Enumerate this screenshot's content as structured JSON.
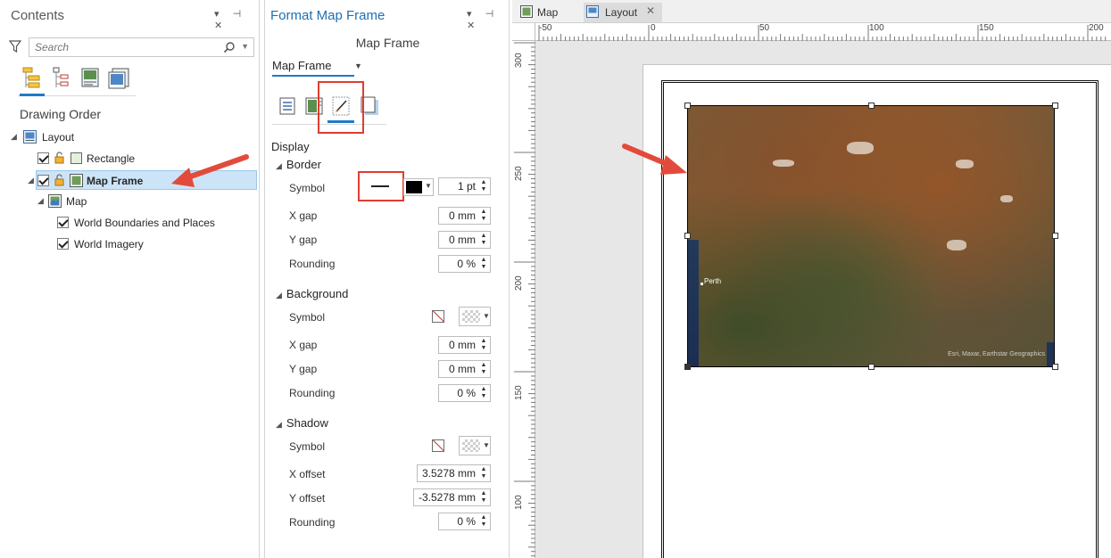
{
  "contents_pane": {
    "title": "Contents",
    "controls": "▾ ⊣ ✕",
    "search_placeholder": "Search",
    "view_tabs": [
      "list-by-drawing-order-icon",
      "list-by-selection-icon",
      "list-by-snapping-icon",
      "list-by-labeling-icon"
    ],
    "heading": "Drawing Order",
    "tree": {
      "layout": "Layout",
      "rectangle": "Rectangle",
      "map_frame": "Map Frame",
      "map": "Map",
      "world_boundaries": "World Boundaries and Places",
      "world_imagery": "World Imagery"
    }
  },
  "format_pane": {
    "title": "Format Map Frame",
    "controls": "▾ ⊣ ✕",
    "subtitle": "Map Frame",
    "element_select": "Map Frame",
    "tabs": [
      "options-icon",
      "placement-icon",
      "display-icon",
      "shadow-icon"
    ],
    "active_tab": "display-icon",
    "section": "Display",
    "border": {
      "label": "Border",
      "symbol_label": "Symbol",
      "line_weight": "1 pt",
      "color": "#000000",
      "x_gap_label": "X gap",
      "x_gap": "0 mm",
      "y_gap_label": "Y gap",
      "y_gap": "0 mm",
      "rounding_label": "Rounding",
      "rounding": "0 %"
    },
    "background": {
      "label": "Background",
      "symbol_label": "Symbol",
      "x_gap_label": "X gap",
      "x_gap": "0 mm",
      "y_gap_label": "Y gap",
      "y_gap": "0 mm",
      "rounding_label": "Rounding",
      "rounding": "0 %"
    },
    "shadow": {
      "label": "Shadow",
      "symbol_label": "Symbol",
      "x_offset_label": "X offset",
      "x_offset": "3.5278 mm",
      "y_offset_label": "Y offset",
      "y_offset": "-3.5278 mm",
      "rounding_label": "Rounding",
      "rounding": "0 %"
    }
  },
  "layout_view": {
    "tabs": [
      {
        "label": "Map"
      },
      {
        "label": "Layout"
      }
    ],
    "ruler_h": [
      "-50",
      "0",
      "50",
      "100",
      "150",
      "200"
    ],
    "ruler_v": [
      "300",
      "250",
      "200",
      "150",
      "100"
    ],
    "map_labels": {
      "city": "Perth",
      "credits": "Esri, Maxar, Earthstar Geographics"
    }
  },
  "colors": {
    "accent": "#1f7ac6",
    "highlight": "#e03c31",
    "selection": "#cce4f7"
  }
}
